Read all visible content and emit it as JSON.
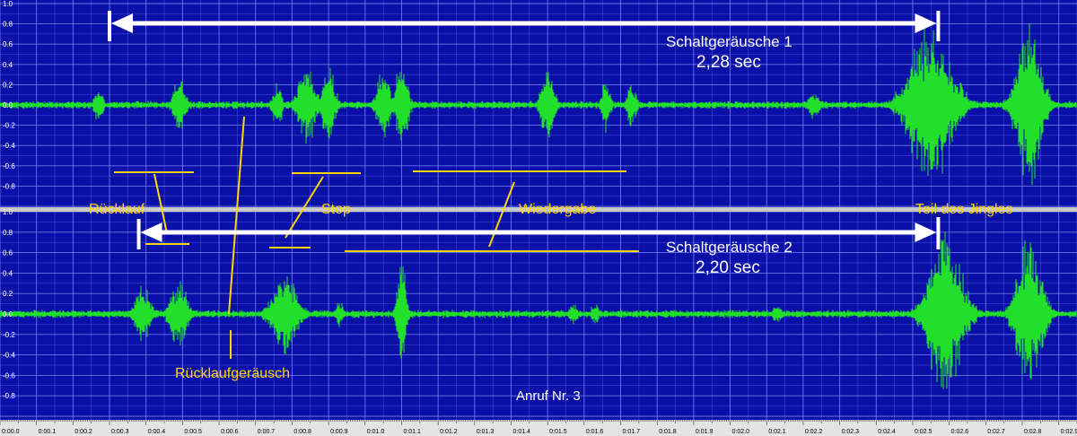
{
  "chart_data": {
    "type": "line",
    "xlabel": "",
    "ylabel": "",
    "x_range_sec": [
      0.0,
      2.95
    ],
    "y_range": [
      -1.0,
      1.0
    ],
    "grid": true,
    "y_tick_values": [
      1.0,
      0.8,
      0.6,
      0.4,
      0.2,
      0.0,
      -0.2,
      -0.4,
      -0.6,
      -0.8
    ],
    "y_tick_labels": [
      "1.0",
      "0.8",
      "0.6",
      "0.4",
      "0.2",
      "0.0",
      "-0.2",
      "-0.4",
      "-0.6",
      "-0.8"
    ],
    "x_tick_labels": [
      "0:00.0",
      "0:00.1",
      "0:00.2",
      "0:00.3",
      "0:00.4",
      "0:00.5",
      "0:00.6",
      "0:00.7",
      "0:00.8",
      "0:00.9",
      "0:01.0",
      "0:01.1",
      "0:01.2",
      "0:01.3",
      "0:01.4",
      "0:01.5",
      "0:01.6",
      "0:01.7",
      "0:01.8",
      "0:01.9",
      "0:02.0",
      "0:02.1",
      "0:02.2",
      "0:02.3",
      "0:02.4",
      "0:02.5",
      "0:02.6",
      "0:02.7",
      "0:02.8",
      "0:02.9"
    ],
    "background_color": "#0a0fa8",
    "grid_color": "#8a96ff",
    "wave_color": "#22e02a",
    "annotation_color": "#ffd700",
    "series": [
      {
        "noise": 0.03,
        "bursts": [
          {
            "t": 0.27,
            "amp": 0.2,
            "w": 0.01
          },
          {
            "t": 0.49,
            "amp": 0.3,
            "w": 0.015
          },
          {
            "t": 0.76,
            "amp": 0.3,
            "w": 0.01
          },
          {
            "t": 0.84,
            "amp": 0.5,
            "w": 0.02
          },
          {
            "t": 0.9,
            "amp": 0.45,
            "w": 0.015
          },
          {
            "t": 1.05,
            "amp": 0.45,
            "w": 0.015
          },
          {
            "t": 1.1,
            "amp": 0.5,
            "w": 0.015
          },
          {
            "t": 1.5,
            "amp": 0.45,
            "w": 0.015
          },
          {
            "t": 1.66,
            "amp": 0.3,
            "w": 0.01
          },
          {
            "t": 1.73,
            "amp": 0.3,
            "w": 0.01
          },
          {
            "t": 2.23,
            "amp": 0.15,
            "w": 0.015
          },
          {
            "t": 2.55,
            "amp": 0.9,
            "w": 0.05
          },
          {
            "t": 2.82,
            "amp": 0.85,
            "w": 0.03
          }
        ]
      },
      {
        "noise": 0.03,
        "bursts": [
          {
            "t": 0.39,
            "amp": 0.3,
            "w": 0.02
          },
          {
            "t": 0.49,
            "amp": 0.4,
            "w": 0.02
          },
          {
            "t": 0.78,
            "amp": 0.45,
            "w": 0.03
          },
          {
            "t": 0.93,
            "amp": 0.15,
            "w": 0.01
          },
          {
            "t": 1.1,
            "amp": 0.7,
            "w": 0.01
          },
          {
            "t": 1.57,
            "amp": 0.15,
            "w": 0.01
          },
          {
            "t": 1.63,
            "amp": 0.12,
            "w": 0.01
          },
          {
            "t": 2.13,
            "amp": 0.12,
            "w": 0.01
          },
          {
            "t": 2.59,
            "amp": 0.9,
            "w": 0.04
          },
          {
            "t": 2.82,
            "amp": 0.85,
            "w": 0.03
          }
        ]
      }
    ],
    "annotations": {
      "schalt1_label": "Schaltgeräusche 1",
      "schalt1_value": "2,28 sec",
      "schalt1_start_sec": 0.3,
      "schalt1_end_sec": 2.57,
      "schalt2_label": "Schaltgeräusche 2",
      "schalt2_value": "2,20 sec",
      "schalt2_start_sec": 0.38,
      "schalt2_end_sec": 2.57,
      "ruecklauf": "Rücklauf",
      "stop": "Stop",
      "wiedergabe": "Wiedergabe",
      "teil_des_jingles": "Teil des Jingles",
      "ruecklaufgeraeusch": "Rücklaufgeräusch",
      "anruf": "Anruf Nr. 3"
    }
  }
}
